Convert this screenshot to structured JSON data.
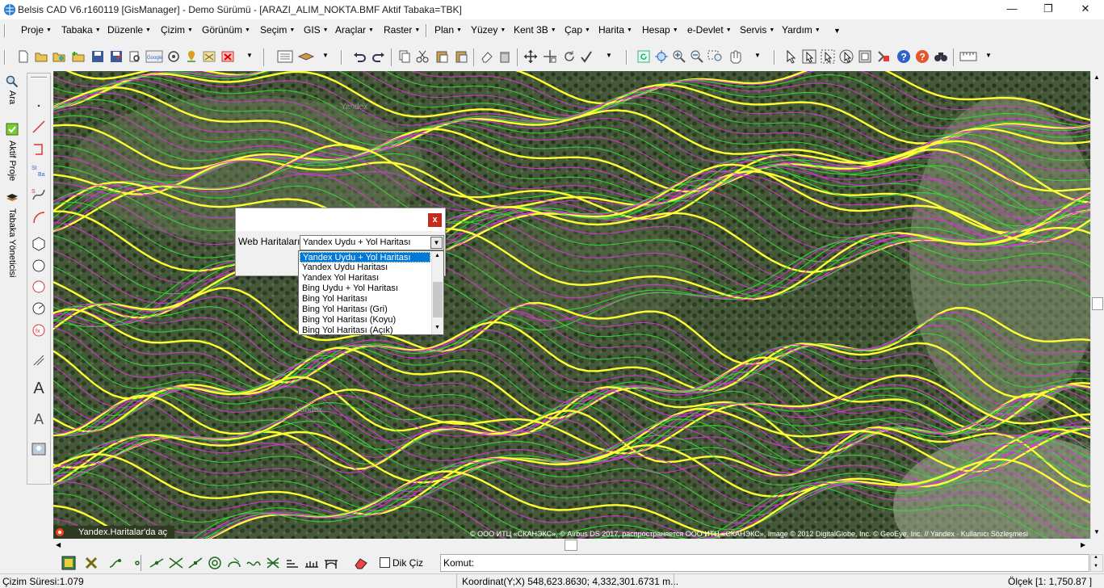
{
  "window": {
    "title": "Belsis CAD V6.r160119 [GisManager] - Demo Sürümü - [ARAZI_ALIM_NOKTA.BMF  Aktif Tabaka=TBK]",
    "minimize": "—",
    "maximize": "❐",
    "close": "✕"
  },
  "menu": [
    "Proje",
    "Tabaka",
    "Düzenle",
    "Çizim",
    "Görünüm",
    "Seçim",
    "GIS",
    "Araçlar",
    "Raster",
    "Plan",
    "Yüzey",
    "Kent 3B",
    "Çap",
    "Harita",
    "Hesap",
    "e-Devlet",
    "Servis",
    "Yardım"
  ],
  "left_panel": {
    "search": "Ara",
    "active_project": "Aktif Proje",
    "layer_manager": "Tabaka Yöneticisi"
  },
  "map": {
    "watermark_label": "Yandex",
    "tab_label": "Yandex.Haritalar'da aç",
    "copyright": "© ООО ИТЦ «СКАНЭКС», © Airbus DS 2017, распространяется ООО ИТЦ «СКАНЭКС», Image © 2012 DigitalGlobe, Inc. © GeoEye, Inc. // Yandex · Kullanıcı Sözleşmesi"
  },
  "dialog": {
    "close": "x",
    "label": "Web Haritaları:",
    "selected": "Yandex Uydu + Yol Haritası",
    "options": [
      "Yandex Uydu + Yol Haritası",
      "Yandex Uydu Haritası",
      "Yandex Yol Haritası",
      "Bing Uydu + Yol Haritası",
      "Bing Yol Haritası",
      "Bing Yol Haritası (Gri)",
      "Bing Yol Haritası (Koyu)",
      "Bing Yol Haritası (Açık)"
    ]
  },
  "bottom": {
    "dik_ciz": "Dik Çiz",
    "komut_label": "Komut:",
    "komut_value": ""
  },
  "status": {
    "draw_time": "Çizim Süresi:1.079",
    "coord": "Koordinat(Y;X)  548,623.8630; 4,332,301.6731 m...",
    "scale": "Ölçek [1: 1,750.87 ]"
  },
  "colors": {
    "contour_major": "#ffff33",
    "contour_green": "#33dd33",
    "contour_magenta": "#dd33dd",
    "accent": "#0078d7"
  }
}
